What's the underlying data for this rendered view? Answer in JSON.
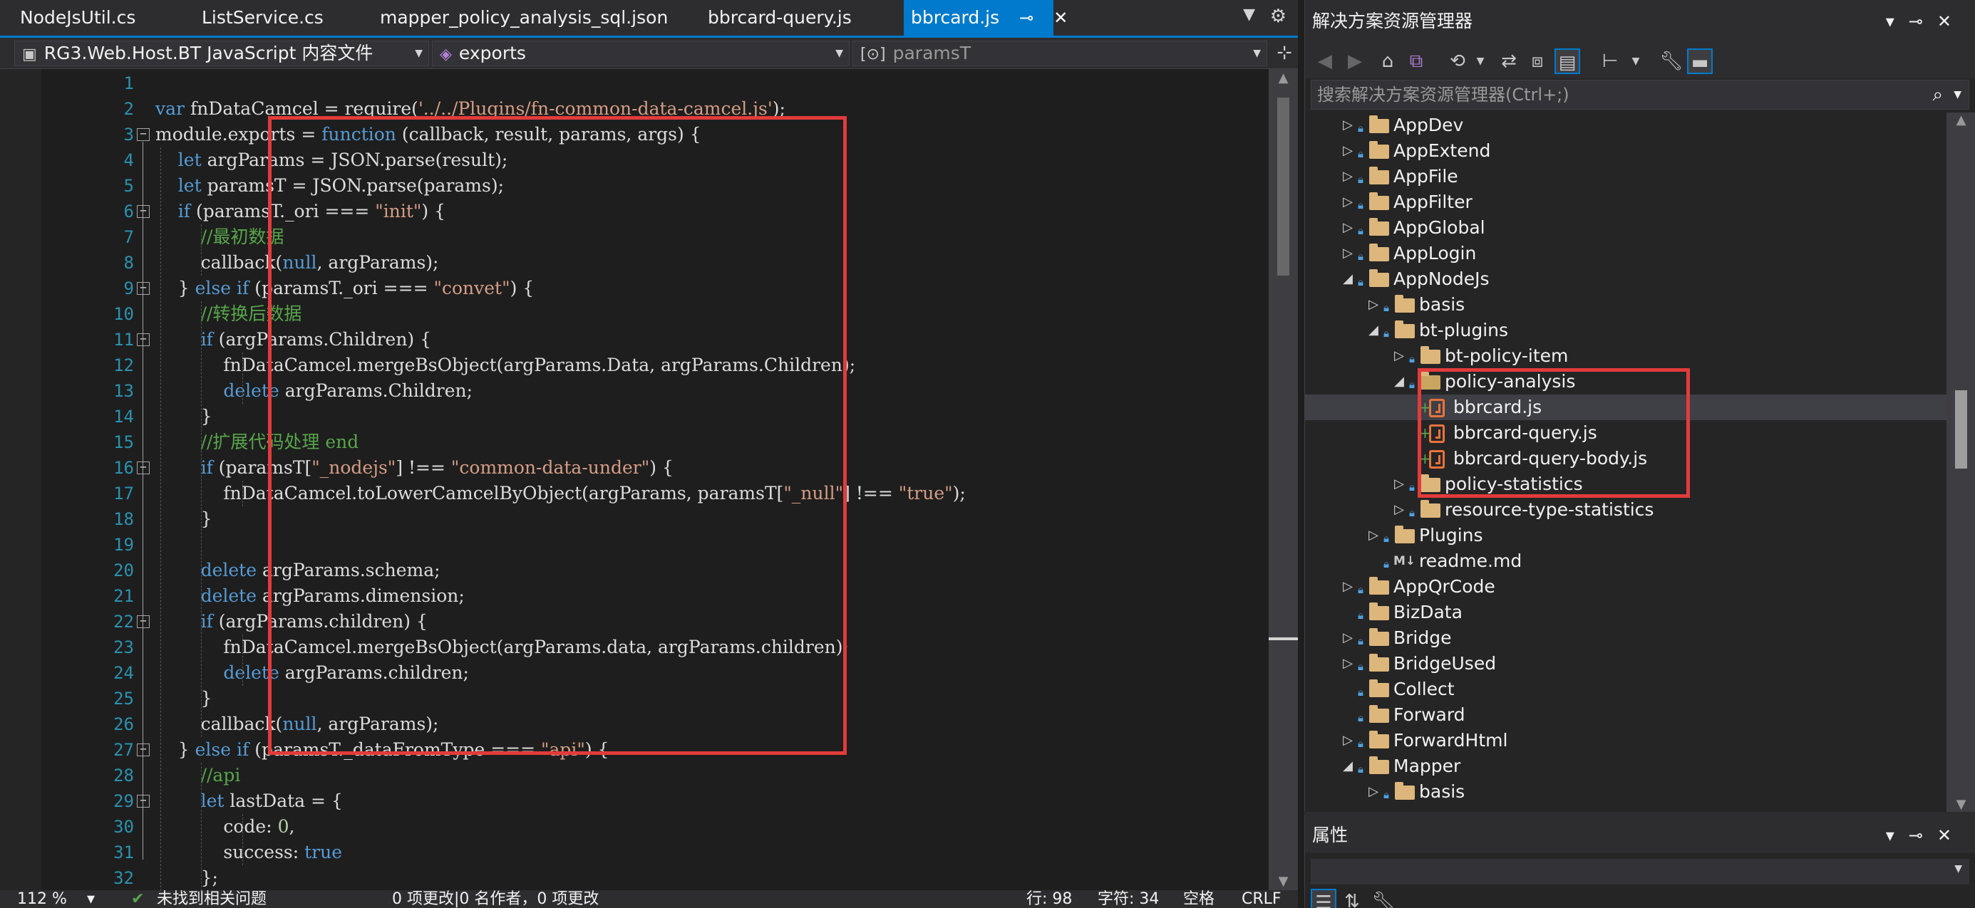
{
  "editor": {
    "tabs": [
      {
        "label": "NodeJsUtil.cs",
        "active": false
      },
      {
        "label": "ListService.cs",
        "active": false
      },
      {
        "label": "mapper_policy_analysis_sql.json",
        "active": false
      },
      {
        "label": "bbrcard-query.js",
        "active": false
      },
      {
        "label": "bbrcard.js",
        "active": true
      }
    ],
    "nav": {
      "project": "RG3.Web.Host.BT JavaScript 内容文件",
      "scope": "exports",
      "member": "paramsT"
    },
    "line_numbers": [
      "1",
      "2",
      "3",
      "4",
      "5",
      "6",
      "7",
      "8",
      "9",
      "10",
      "11",
      "12",
      "13",
      "14",
      "15",
      "16",
      "17",
      "18",
      "19",
      "20",
      "21",
      "22",
      "23",
      "24",
      "25",
      "26",
      "27",
      "28",
      "29",
      "30",
      "31",
      "32"
    ],
    "code_lines": [
      "",
      "var fnDataCamcel = require('../../Plugins/fn-common-data-camcel.js');",
      "module.exports = function (callback, result, params, args) {",
      "    let argParams = JSON.parse(result);",
      "    let paramsT = JSON.parse(params);",
      "    if (paramsT._ori === \"init\") {",
      "        //最初数据",
      "        callback(null, argParams);",
      "    } else if (paramsT._ori === \"convet\") {",
      "        //转换后数据",
      "        if (argParams.Children) {",
      "            fnDataCamcel.mergeBsObject(argParams.Data, argParams.Children);",
      "            delete argParams.Children;",
      "        }",
      "        //扩展代码处理 end",
      "        if (paramsT[\"_nodejs\"] !== \"common-data-under\") {",
      "            fnDataCamcel.toLowerCamcelByObject(argParams, paramsT[\"_null\"] !== \"true\");",
      "        }",
      "",
      "        delete argParams.schema;",
      "        delete argParams.dimension;",
      "        if (argParams.children) {",
      "            fnDataCamcel.mergeBsObject(argParams.data, argParams.children);",
      "            delete argParams.children;",
      "        }",
      "        callback(null, argParams);",
      "    } else if (paramsT._dataFromType === \"api\") {",
      "        //api",
      "        let lastData = {",
      "            code: 0,",
      "            success: true",
      "        };"
    ],
    "status": {
      "zoom": "112 %",
      "issues": "未找到相关问题",
      "changes": "0 项更改|0 名作者，0 项更改",
      "line": "行: 98",
      "char": "字符: 34",
      "whitespace": "空格",
      "eol": "CRLF"
    }
  },
  "solution_explorer": {
    "title": "解决方案资源管理器",
    "search_placeholder": "搜索解决方案资源管理器(Ctrl+;)",
    "items": [
      {
        "label": "AppDev",
        "depth": 0,
        "expander": "collapsed",
        "kind": "folder"
      },
      {
        "label": "AppExtend",
        "depth": 0,
        "expander": "collapsed",
        "kind": "folder"
      },
      {
        "label": "AppFile",
        "depth": 0,
        "expander": "collapsed",
        "kind": "folder"
      },
      {
        "label": "AppFilter",
        "depth": 0,
        "expander": "collapsed",
        "kind": "folder"
      },
      {
        "label": "AppGlobal",
        "depth": 0,
        "expander": "collapsed",
        "kind": "folder"
      },
      {
        "label": "AppLogin",
        "depth": 0,
        "expander": "collapsed",
        "kind": "folder"
      },
      {
        "label": "AppNodeJs",
        "depth": 0,
        "expander": "expanded",
        "kind": "folder"
      },
      {
        "label": "basis",
        "depth": 1,
        "expander": "collapsed",
        "kind": "folder"
      },
      {
        "label": "bt-plugins",
        "depth": 1,
        "expander": "expanded",
        "kind": "folder"
      },
      {
        "label": "bt-policy-item",
        "depth": 2,
        "expander": "collapsed",
        "kind": "folder"
      },
      {
        "label": "policy-analysis",
        "depth": 2,
        "expander": "expanded",
        "kind": "folder-open"
      },
      {
        "label": "bbrcard.js",
        "depth": 3,
        "expander": "none",
        "kind": "js",
        "selected": true
      },
      {
        "label": "bbrcard-query.js",
        "depth": 3,
        "expander": "none",
        "kind": "js"
      },
      {
        "label": "bbrcard-query-body.js",
        "depth": 3,
        "expander": "none",
        "kind": "js"
      },
      {
        "label": "policy-statistics",
        "depth": 2,
        "expander": "collapsed",
        "kind": "folder"
      },
      {
        "label": "resource-type-statistics",
        "depth": 2,
        "expander": "collapsed",
        "kind": "folder"
      },
      {
        "label": "Plugins",
        "depth": 1,
        "expander": "collapsed",
        "kind": "folder"
      },
      {
        "label": "readme.md",
        "depth": 1,
        "expander": "none",
        "kind": "md"
      },
      {
        "label": "AppQrCode",
        "depth": 0,
        "expander": "collapsed",
        "kind": "folder"
      },
      {
        "label": "BizData",
        "depth": 0,
        "expander": "none",
        "kind": "folder"
      },
      {
        "label": "Bridge",
        "depth": 0,
        "expander": "collapsed",
        "kind": "folder"
      },
      {
        "label": "BridgeUsed",
        "depth": 0,
        "expander": "collapsed",
        "kind": "folder"
      },
      {
        "label": "Collect",
        "depth": 0,
        "expander": "none",
        "kind": "folder"
      },
      {
        "label": "Forward",
        "depth": 0,
        "expander": "none",
        "kind": "folder"
      },
      {
        "label": "ForwardHtml",
        "depth": 0,
        "expander": "collapsed",
        "kind": "folder"
      },
      {
        "label": "Mapper",
        "depth": 0,
        "expander": "expanded",
        "kind": "folder"
      },
      {
        "label": "basis",
        "depth": 1,
        "expander": "collapsed",
        "kind": "folder"
      }
    ]
  },
  "properties": {
    "title": "属性"
  },
  "colors": {
    "accent": "#007acc",
    "highlight_box": "#e33b3b",
    "keyword": "#569cd6",
    "string": "#d69d85",
    "comment": "#57a64a"
  }
}
